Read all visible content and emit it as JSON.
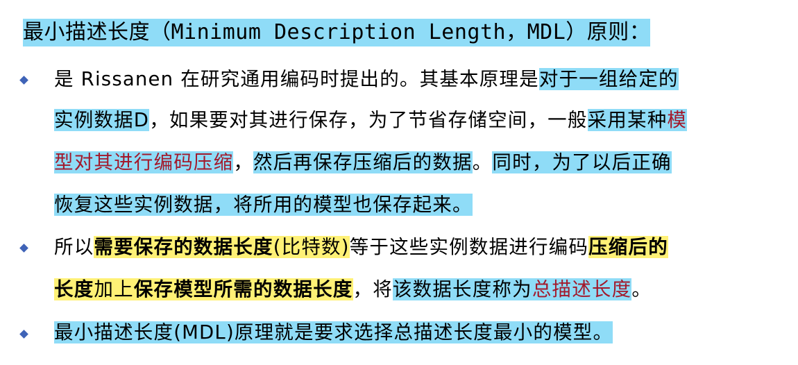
{
  "title": {
    "part1": "最小描述长度（",
    "part2": "Minimum Description Length，MDL",
    "part3": "）原则："
  },
  "bullet1": {
    "l1a": "是 Rissanen 在研究通用编码时提出的。其基本原理是",
    "l1b": "对于一组给定的",
    "l2a": "实例数据D",
    "l2b": "，如果要对其进行保存，为了节省存储空间，一般",
    "l2c": "采用某种",
    "l2d": "模",
    "l3a": "型对其进行编码压缩",
    "l3b": "，",
    "l3c": "然后再保存压缩后的数据",
    "l3d": "。",
    "l3e": "同时，为了以后正确",
    "l4a": "恢复这些实例数据，将所用的模型也保存起来。"
  },
  "bullet2": {
    "l1a": "所以",
    "l1b": "需要保存的数据长度",
    "l1c": "(比特数)",
    "l1d": "等于这些实例数据进行编码",
    "l1e": "压缩后的",
    "l2a": "长度",
    "l2b": "加上",
    "l2c": "保存模型所需的数据长度",
    "l2d": "，将",
    "l2e": "该数据长度称为",
    "l2f": "总描述长度",
    "l2g": "。"
  },
  "bullet3": {
    "l1a": "最小描述长度(MDL)原理就是要求选择总描述长度最小的模型。"
  },
  "colors": {
    "cyan_highlight": "#8fdcf7",
    "yellow_highlight": "#fff176",
    "red_text": "#a3192b",
    "bullet": "#3f63b7"
  }
}
